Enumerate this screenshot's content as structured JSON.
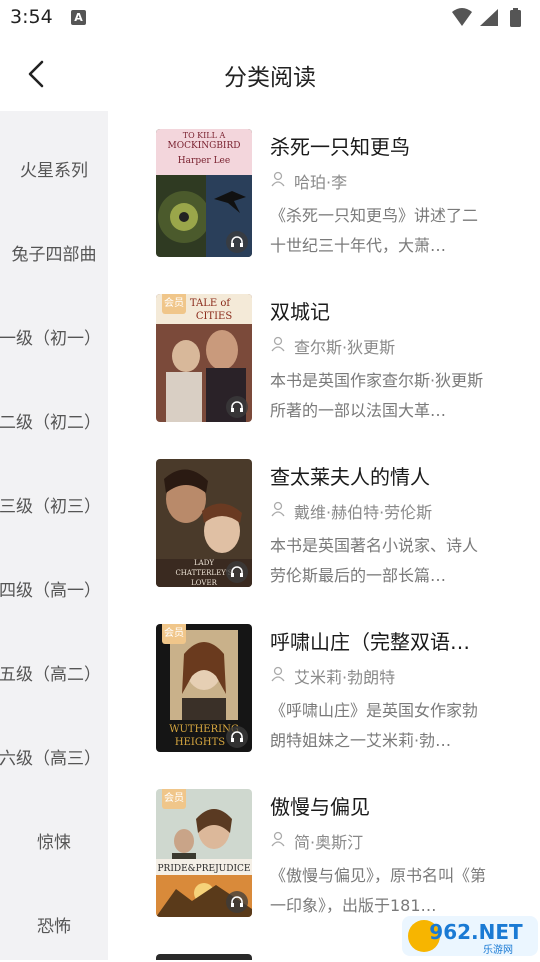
{
  "status": {
    "time": "3:54",
    "notification_badge": "A"
  },
  "header": {
    "title": "分类阅读",
    "back_icon": "chevron-left-icon"
  },
  "sidebar": {
    "items": [
      {
        "label": "火星系列"
      },
      {
        "label": "兔子四部曲"
      },
      {
        "label": "一级（初一）"
      },
      {
        "label": "二级（初二）"
      },
      {
        "label": "三级（初三）"
      },
      {
        "label": "四级（高一）"
      },
      {
        "label": "五级（高二）"
      },
      {
        "label": "六级（高三）"
      },
      {
        "label": "惊悚"
      },
      {
        "label": "恐怖"
      }
    ]
  },
  "books": [
    {
      "title": "杀死一只知更鸟",
      "author": "哈珀·李",
      "description": "《杀死一只知更鸟》讲述了二十世纪三十年代，大萧…",
      "badge": "",
      "cover_text": [
        "TO KILL A",
        "MOCKINGBIRD",
        "Harper Lee"
      ]
    },
    {
      "title": "双城记",
      "author": "查尔斯·狄更斯",
      "description": "本书是英国作家查尔斯·狄更斯所著的一部以法国大革…",
      "badge": "会员",
      "cover_text": [
        "TALE of",
        "CITIES"
      ]
    },
    {
      "title": "查太莱夫人的情人",
      "author": "戴维·赫伯特·劳伦斯",
      "description": "本书是英国著名小说家、诗人劳伦斯最后的一部长篇…",
      "badge": "",
      "cover_text": [
        "LADY",
        "CHATTERLEY'S",
        "LOVER"
      ]
    },
    {
      "title": "呼啸山庄（完整双语…",
      "author": "艾米莉·勃朗特",
      "description": "《呼啸山庄》是英国女作家勃朗特姐妹之一艾米莉·勃…",
      "badge": "会员",
      "cover_text": [
        "WUTHERING",
        "HEIGHTS"
      ]
    },
    {
      "title": "傲慢与偏见",
      "author": "简·奥斯汀",
      "description": "《傲慢与偏见》，原书名叫《第一印象》，出版于181…",
      "badge": "会员",
      "cover_text": [
        "PRIDE&PREJUDICE"
      ]
    }
  ],
  "watermark": {
    "text": "962.NET",
    "subtext": "乐游网"
  },
  "colors": {
    "sidebar_bg": "#f2f2f4",
    "vip_badge": "#f0c68a",
    "muted_text": "#8a8a8a"
  }
}
